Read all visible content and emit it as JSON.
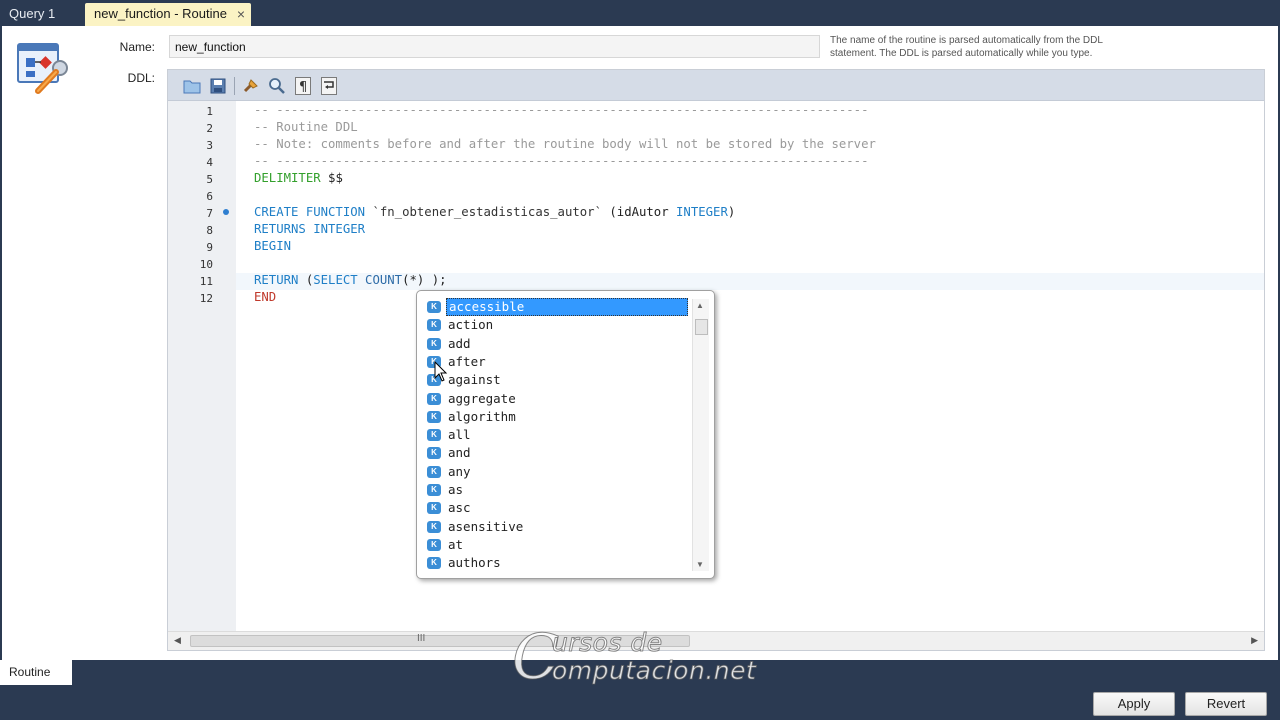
{
  "tabs": [
    {
      "label": "Query 1"
    },
    {
      "label": "new_function - Routine",
      "close": "×"
    }
  ],
  "form": {
    "name_label": "Name:",
    "name_value": "new_function",
    "ddl_label": "DDL:",
    "hint": "The name of the routine is parsed automatically from the DDL statement. The DDL is parsed automatically while you type."
  },
  "toolbar_icons": [
    "open-folder-icon",
    "save-icon",
    "beautify-brush-icon",
    "find-icon",
    "paragraph-marks-icon",
    "word-wrap-icon"
  ],
  "editor": {
    "line_numbers": [
      "1",
      "2",
      "3",
      "4",
      "5",
      "6",
      "7",
      "8",
      "9",
      "10",
      "11",
      "12"
    ],
    "lines": {
      "l1": "-- --------------------------------------------------------------------------------",
      "l2": "-- Routine DDL",
      "l3": "-- Note: comments before and after the routine body will not be stored by the server",
      "l4": "-- --------------------------------------------------------------------------------",
      "l5_kw": "DELIMITER",
      "l5_rest": " $$",
      "l7_kw": "CREATE FUNCTION",
      "l7_name": " `fn_obtener_estadisticas_autor`",
      "l7_paren": " (idAutor",
      "l7_type": " INTEGER",
      "l7_close": ")",
      "l8": "RETURNS INTEGER",
      "l9": "BEGIN",
      "l11_kw": "RETURN",
      "l11_p": " (",
      "l11_sel": "SELECT",
      "l11_fn": " COUNT",
      "l11_rest": "(*) );",
      "l12": "END"
    },
    "scroll_grip": "III"
  },
  "autocomplete": {
    "badge": "K",
    "items": [
      "accessible",
      "action",
      "add",
      "after",
      "against",
      "aggregate",
      "algorithm",
      "all",
      "and",
      "any",
      "as",
      "asc",
      "asensitive",
      "at",
      "authors"
    ],
    "selected_index": 0
  },
  "bottom": {
    "tab_label": "Routine",
    "apply_label": "Apply",
    "revert_label": "Revert"
  },
  "watermark": {
    "line1": "ursos de",
    "line2": "omputacion.net",
    "initial": "C"
  },
  "colors": {
    "keyword": "#1f7fc7",
    "comment": "#9a9a9a",
    "delimiter": "#33a02c",
    "end": "#c0392b",
    "selection": "#3399ff",
    "active_tab": "#fbf3c4",
    "frame": "#2b3a52"
  }
}
